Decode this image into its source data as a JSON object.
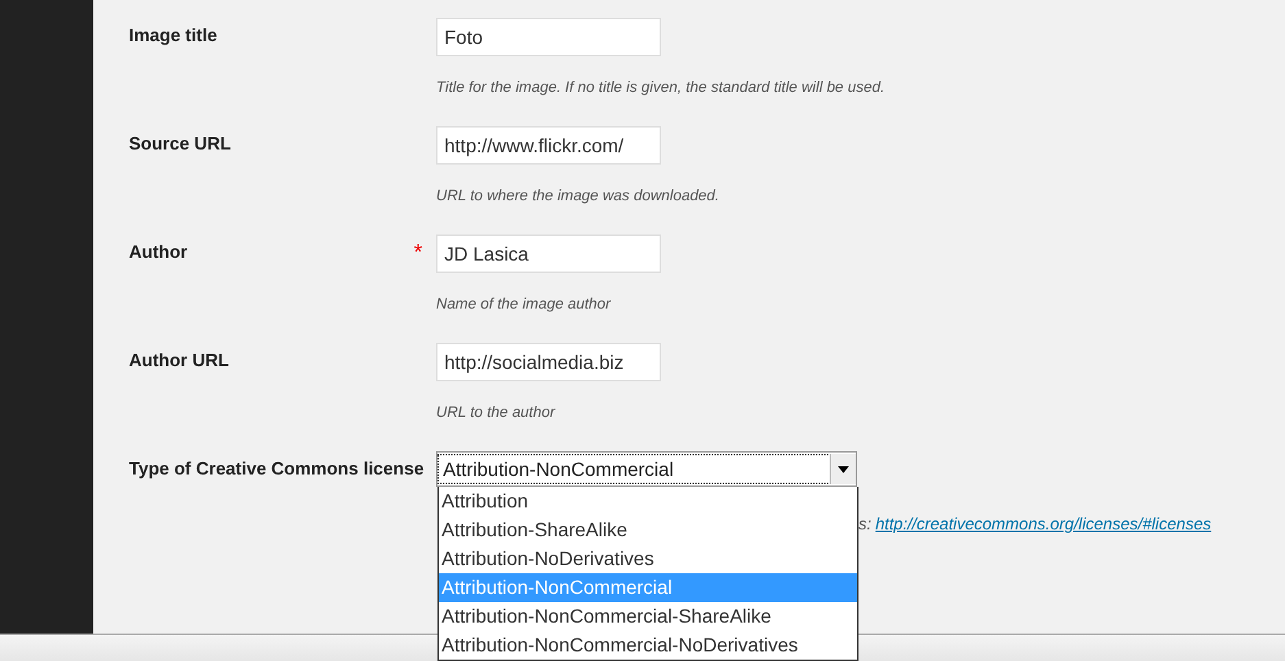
{
  "fields": [
    {
      "label": "Image title",
      "value": "Foto",
      "help": "Title for the image. If no title is given, the standard title will be used."
    },
    {
      "label": "Source URL",
      "value": "http://www.flickr.com/",
      "help": "URL to where the image was downloaded."
    },
    {
      "label": "Author",
      "required_mark": "*",
      "value": "JD Lasica",
      "help": "Name of the image author"
    },
    {
      "label": "Author URL",
      "value": "http://socialmedia.biz",
      "help": "URL to the author"
    }
  ],
  "license": {
    "label": "Type of Creative Commons license",
    "value": "Attribution-NonCommercial",
    "expanded": true,
    "help_visible": "s:",
    "help_link": "http://creativecommons.org/licenses/#licenses",
    "options": [
      {
        "label": "Attribution",
        "selected": false
      },
      {
        "label": "Attribution-ShareAlike",
        "selected": false
      },
      {
        "label": "Attribution-NoDerivatives",
        "selected": false
      },
      {
        "label": "Attribution-NonCommercial",
        "selected": true
      },
      {
        "label": "Attribution-NonCommercial-ShareAlike",
        "selected": false
      },
      {
        "label": "Attribution-NonCommercial-NoDerivatives",
        "selected": false
      }
    ]
  }
}
